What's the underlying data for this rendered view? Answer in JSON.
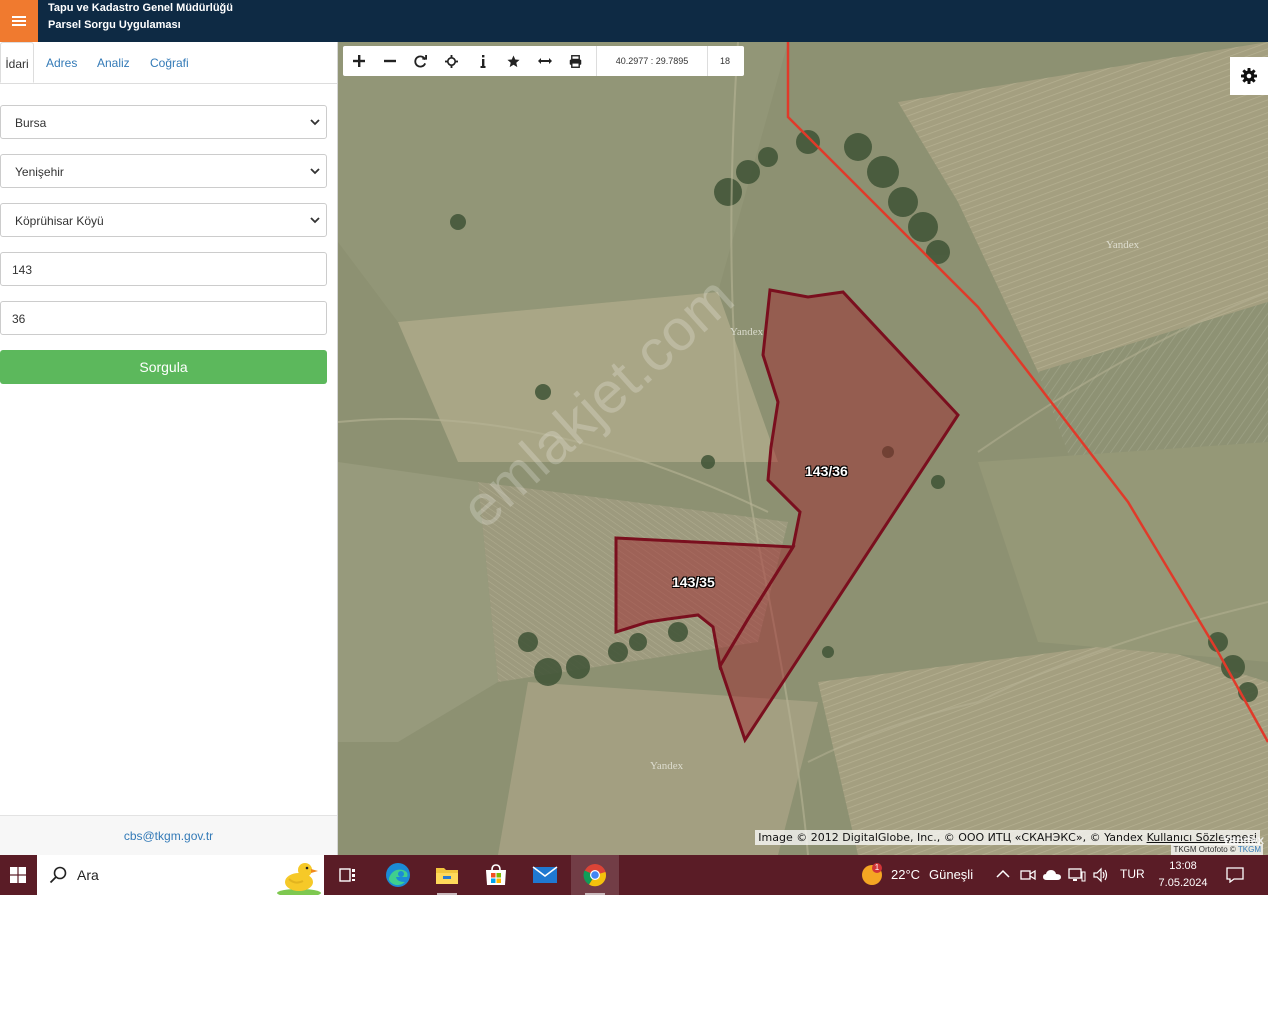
{
  "header": {
    "title_line1": "Tapu ve Kadastro Genel Müdürlüğü",
    "title_line2": "Parsel Sorgu Uygulaması",
    "menu_icon": "hamburger-icon",
    "accent_color": "#f07a2f",
    "bar_color": "#0e2a44"
  },
  "tabs": [
    {
      "label": "İdari",
      "active": true
    },
    {
      "label": "Adres",
      "active": false
    },
    {
      "label": "Analiz",
      "active": false
    },
    {
      "label": "Coğrafi",
      "active": false
    }
  ],
  "form": {
    "province": "Bursa",
    "district": "Yenişehir",
    "neighborhood": "Köprühisar Köyü",
    "block_no": "143",
    "parcel_no": "36",
    "submit_label": "Sorgula",
    "submit_color": "#5cb85c"
  },
  "footer": {
    "email": "cbs@tkgm.gov.tr"
  },
  "map": {
    "toolbar": {
      "tools": [
        "plus-icon",
        "minus-icon",
        "refresh-icon",
        "locate-icon",
        "info-icon",
        "star-icon",
        "measure-icon",
        "print-icon"
      ],
      "coordinates": "40.2977 : 29.7895",
      "zoom": "18"
    },
    "settings_icon": "gear-icon",
    "parcels": [
      {
        "label": "143/36"
      },
      {
        "label": "143/35"
      }
    ],
    "yandex_labels": [
      "Yandex",
      "Yandex",
      "Yandex"
    ],
    "watermark": "emlakjet.com",
    "attribution_prefix": "Image © 2012 DigitalGlobe, Inc., © ООО ИТЦ «СКАНЭКС», © Yandex ",
    "attribution_link": "Kullanıcı Sözleşmesi",
    "yandex_corner": "Yandex",
    "ortho_credit_prefix": "TKGM Ortofoto © ",
    "ortho_credit_link": "TKGM",
    "parcel_color": "#7a0f1e",
    "boundary_color": "#e03a2a"
  },
  "taskbar": {
    "search_label": "Ara",
    "apps": [
      "task-view-icon",
      "edge-icon",
      "file-explorer-icon",
      "store-icon",
      "mail-icon",
      "chrome-icon"
    ],
    "weather_badge": "1",
    "temperature": "22°C",
    "weather_text": "Güneşli",
    "language": "TUR",
    "time": "13:08",
    "date": "7.05.2024",
    "bar_color": "#5a1c26"
  }
}
